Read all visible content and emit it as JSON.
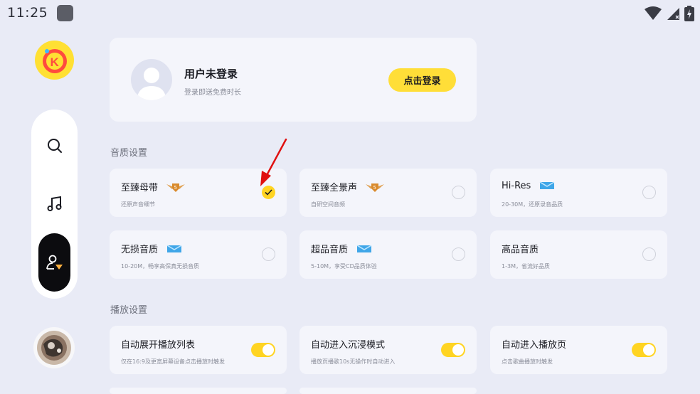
{
  "status_bar": {
    "time": "11:25"
  },
  "login": {
    "title": "用户未登录",
    "subtitle": "登录即送免费时长",
    "button": "点击登录"
  },
  "sections": {
    "quality": "音质设置",
    "playback": "播放设置"
  },
  "quality_options": [
    {
      "title": "至臻母带",
      "desc": "还原声音细节",
      "badge": "svip-badge",
      "selected": true
    },
    {
      "title": "至臻全景声",
      "desc": "自研空间音频",
      "badge": "svip-badge",
      "selected": false
    },
    {
      "title": "Hi-Res",
      "desc": "20-30M，还原录音品质",
      "badge": "vip-badge",
      "selected": false
    },
    {
      "title": "无损音质",
      "desc": "10-20M，畅享高保真无损音质",
      "badge": "vip-badge",
      "selected": false
    },
    {
      "title": "超品音质",
      "desc": "5-10M，享受CD品质体验",
      "badge": "vip-badge",
      "selected": false
    },
    {
      "title": "高品音质",
      "desc": "1-3M，省流好品质",
      "badge": "",
      "selected": false
    }
  ],
  "playback_options": [
    {
      "title": "自动展开播放列表",
      "desc": "仅在16:9及更宽屏幕设备点击播放时触发",
      "enabled": true
    },
    {
      "title": "自动进入沉浸模式",
      "desc": "播放页播歌10s无操作时自动进入",
      "enabled": true
    },
    {
      "title": "自动进入播放页",
      "desc": "点击歌曲播放时触发",
      "enabled": true
    }
  ],
  "colors": {
    "accent": "#ffd422",
    "background": "#e9ebf6",
    "card": "#f4f5fb"
  }
}
